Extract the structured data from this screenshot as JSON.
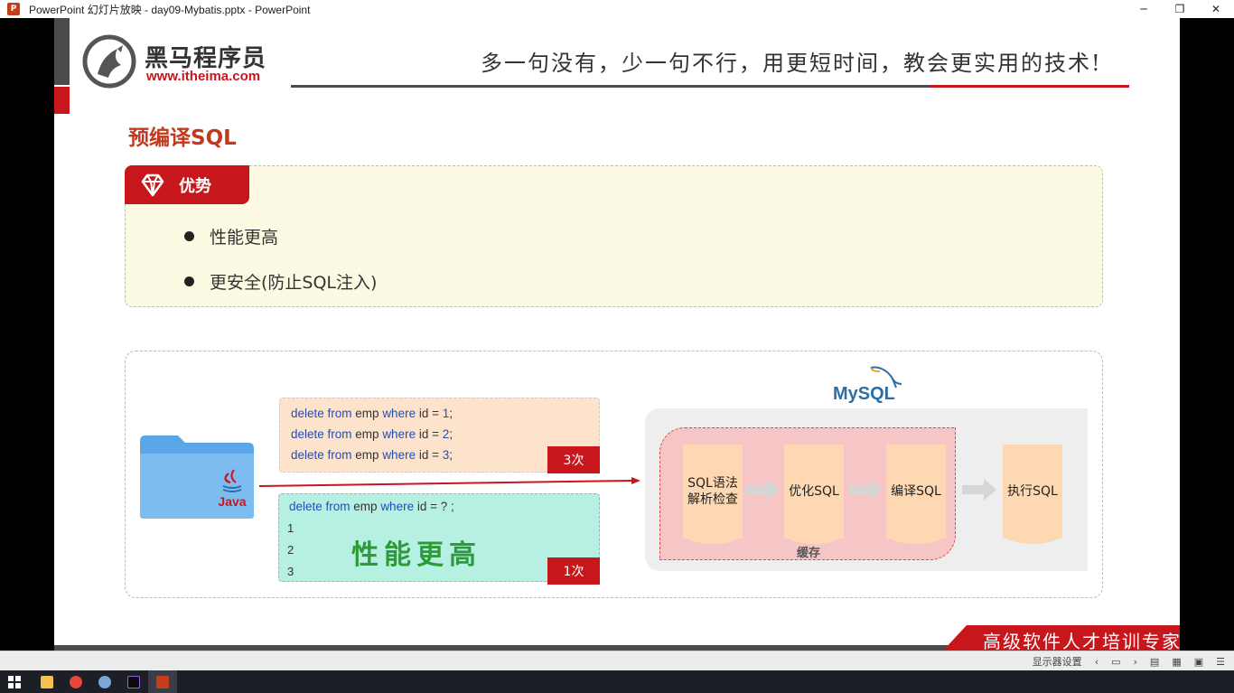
{
  "window": {
    "title": "PowerPoint 幻灯片放映  -  day09-Mybatis.pptx - PowerPoint",
    "app_icon": "P",
    "minimize": "─",
    "maximize": "❐",
    "close": "✕"
  },
  "slide": {
    "brand_name": "黑马程序员",
    "brand_url": "www.itheima.com",
    "slogan": "多一句没有，少一句不行，用更短时间，教会更实用的技术!",
    "section_title": "预编译SQL",
    "advantages": {
      "tab_label": "优势",
      "items": [
        "性能更高",
        "更安全(防止SQL注入)"
      ]
    },
    "statements": {
      "lines": [
        {
          "a": "delete from",
          "b": " emp ",
          "c": "where",
          "d": " id = ",
          "e": "1",
          "f": ";"
        },
        {
          "a": "delete from",
          "b": " emp ",
          "c": "where",
          "d": " id = ",
          "e": "2",
          "f": ";"
        },
        {
          "a": "delete from",
          "b": " emp ",
          "c": "where",
          "d": " id = ",
          "e": "3",
          "f": ";"
        }
      ],
      "count": "3次"
    },
    "prepared": {
      "a": "delete from",
      "b": " emp ",
      "c": "where",
      "d": " id = ? ;",
      "indexes": [
        "1",
        "2",
        "3"
      ],
      "highlight": "性能更高",
      "count": "1次"
    },
    "folder_label": "Java",
    "mysql_label": "MySQL",
    "pipeline": {
      "steps": [
        "SQL语法\n解析检查",
        "优化SQL",
        "编译SQL",
        "执行SQL"
      ],
      "cache_label": "缓存"
    },
    "banner": "高级软件人才培训专家"
  },
  "statusbar": {
    "display_settings": "显示器设置"
  },
  "colors": {
    "brand_red": "#c8161d",
    "title_red": "#c23a1e",
    "code_blue": "#1e4fb8",
    "perf_green": "#2e9b3a",
    "mysql_blue": "#2d6ea6"
  },
  "icons": {
    "gem": "gem-icon",
    "folder": "folder-icon",
    "java": "java-icon",
    "dolphin": "mysql-dolphin-icon"
  }
}
